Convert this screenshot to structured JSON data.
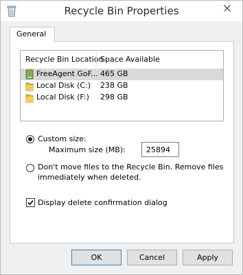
{
  "window": {
    "title": "Recycle Bin Properties",
    "icon": "recycle-bin-icon",
    "close_icon": "close-icon"
  },
  "tabs": [
    {
      "label": "General",
      "selected": true
    }
  ],
  "locations_list": {
    "columns": [
      "Recycle Bin Location",
      "Space Available"
    ],
    "rows": [
      {
        "name": "FreeAgent GoF...",
        "space": "465 GB",
        "icon": "external-drive-icon",
        "selected": true
      },
      {
        "name": "Local Disk (C:)",
        "space": "238 GB",
        "icon": "folder-drive-icon",
        "selected": false
      },
      {
        "name": "Local Disk (F:)",
        "space": "298 GB",
        "icon": "folder-drive-icon",
        "selected": false
      }
    ]
  },
  "options": {
    "custom_size_label": "Custom size:",
    "custom_size_selected": true,
    "max_size_label": "Maximum size (MB):",
    "max_size_value": "25894",
    "dont_move_label_line1": "Don't move files to the Recycle Bin. Remove files",
    "dont_move_label_line2": "immediately when deleted.",
    "dont_move_selected": false,
    "confirm_label": "Display delete confirmation dialog",
    "confirm_checked": true
  },
  "buttons": {
    "ok": "OK",
    "cancel": "Cancel",
    "apply": "Apply"
  },
  "colors": {
    "selected_row": "#d9d9d9",
    "folder_yellow": "#e8b83a",
    "drive_green": "#7fae57"
  }
}
